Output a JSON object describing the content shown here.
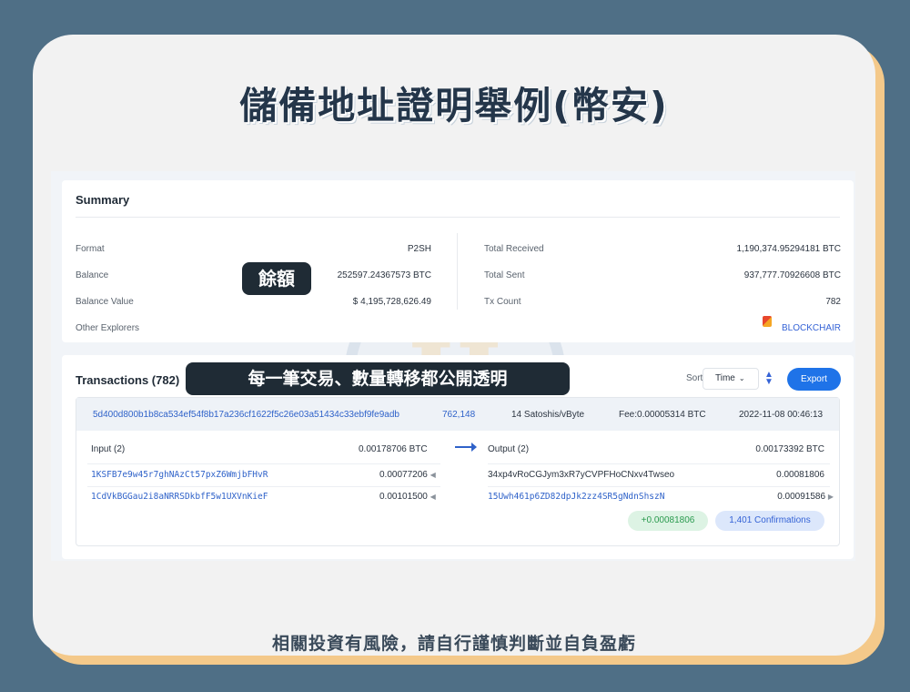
{
  "headline": "儲備地址證明舉例(幣安)",
  "summary": {
    "title": "Summary",
    "rows_left": [
      {
        "label": "Format",
        "value": "P2SH"
      },
      {
        "label": "Balance",
        "value": "252597.24367573 BTC"
      },
      {
        "label": "Balance Value",
        "value": "$ 4,195,728,626.49"
      },
      {
        "label": "Other Explorers",
        "value": ""
      }
    ],
    "rows_right": [
      {
        "label": "Total Received",
        "value": "1,190,374.95294181 BTC"
      },
      {
        "label": "Total Sent",
        "value": "937,777.70926608 BTC"
      },
      {
        "label": "Tx Count",
        "value": "782"
      }
    ],
    "explorer_link": "BLOCKCHAIR",
    "balance_tag": "餘額"
  },
  "transactions": {
    "title": "Transactions (782)",
    "tag": "每一筆交易、數量轉移都公開透明",
    "sort_label": "Sort:",
    "sort_value": "Time",
    "export_label": "Export",
    "tx": {
      "hash": "5d400d800b1b8ca534ef54f8b17a236cf1622f5c26e03a51434c33ebf9fe9adb",
      "block": "762,148",
      "fee_rate": "14 Satoshis/vByte",
      "fee": "Fee:0.00005314 BTC",
      "time": "2022-11-08 00:46:13",
      "input_label": "Input (2)",
      "input_total": "0.00178706 BTC",
      "output_label": "Output (2)",
      "output_total": "0.00173392 BTC",
      "inputs": [
        {
          "address": "1KSFB7e9w45r7ghNAzCt57pxZ6WmjbFHvR",
          "amount": "0.00077206"
        },
        {
          "address": "1CdVkBGGau2i8aNRRSDkbfF5w1UXVnKieF",
          "amount": "0.00101500"
        }
      ],
      "outputs": [
        {
          "address": "34xp4vRoCGJym3xR7yCVPFHoCNxv4Twseo",
          "amount": "0.00081806"
        },
        {
          "address": "15Uwh461p6ZD82dpJk2zz4SR5gNdnShszN",
          "amount": "0.00091586"
        }
      ],
      "delta": "+0.00081806",
      "confirmations": "1,401 Confirmations"
    }
  },
  "disclaimer": "相關投資有風險，請自行謹慎判斷並自負盈虧",
  "colors": {
    "background": "#4f6f86",
    "card": "#f2f2f2",
    "accent_blue": "#1f73e8",
    "link_blue": "#2f62c9",
    "tag_dark": "#1f2b35",
    "positive_green": "#2a9a4e"
  }
}
